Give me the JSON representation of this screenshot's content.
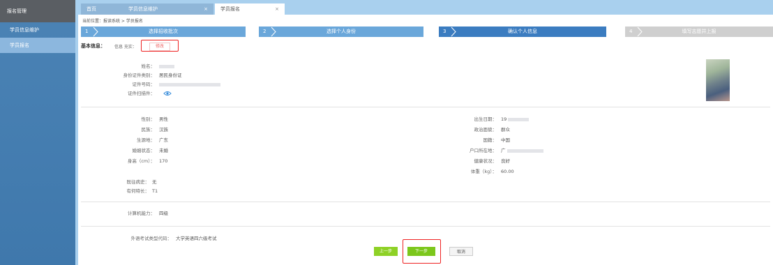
{
  "sidebar": {
    "title": "报名管理",
    "items": [
      {
        "label": "学员信息维护",
        "active": false
      },
      {
        "label": "学员报名",
        "active": true
      }
    ]
  },
  "tabs": [
    {
      "label": "首页",
      "closable": false,
      "active": false
    },
    {
      "label": "学员信息维护",
      "closable": true,
      "active": false
    },
    {
      "label": "学员报名",
      "closable": true,
      "active": true
    }
  ],
  "close_glyph": "×",
  "breadcrumb": "当前位置：报读系统 > 学员报名",
  "steps": [
    {
      "num": "1",
      "label": "选择招收批次"
    },
    {
      "num": "2",
      "label": "选择个人身份"
    },
    {
      "num": "3",
      "label": "确认个人信息"
    },
    {
      "num": "4",
      "label": "填写志愿并上报"
    }
  ],
  "basic_info": {
    "title": "基本信息：",
    "hint": "信息 充实：",
    "edit_label": "修改"
  },
  "identity": {
    "name_label": "姓名：",
    "id_type_label": "身份证件类别：",
    "id_type_value": "居民身份证",
    "id_number_label": "证件号码：",
    "scan_label": "证件扫描件："
  },
  "personal_left": [
    {
      "label": "性别：",
      "value": "男性"
    },
    {
      "label": "民族：",
      "value": "汉族"
    },
    {
      "label": "生源地：",
      "value": "广东"
    },
    {
      "label": "婚姻状态：",
      "value": "未婚"
    },
    {
      "label": "身高（cm）：",
      "value": "170"
    }
  ],
  "personal_right": [
    {
      "label": "出生日期：",
      "value": "19"
    },
    {
      "label": "政治面貌：",
      "value": "群众"
    },
    {
      "label": "国籍：",
      "value": "中国"
    },
    {
      "label": "户口所在地：",
      "value": "广"
    },
    {
      "label": "健康状况：",
      "value": "良好"
    },
    {
      "label": "体重（kg）：",
      "value": "60.00"
    }
  ],
  "extra": [
    {
      "label": "既往病史：",
      "value": "无"
    },
    {
      "label": "有何特长：",
      "value": "T1"
    }
  ],
  "computer": {
    "label": "计算机能力：",
    "value": "四级"
  },
  "foreign": {
    "label": "外语考试类型代码：",
    "value": "大学英语四六级考试"
  },
  "buttons": {
    "prev": "上一步",
    "next": "下一步",
    "cancel": "取消"
  },
  "colors": {
    "step_done": "#6aa7da",
    "step_current": "#3b7cc0",
    "step_todo": "#cfcfcf",
    "primary_green": "#7cc71c",
    "highlight_red": "#ee2222"
  }
}
